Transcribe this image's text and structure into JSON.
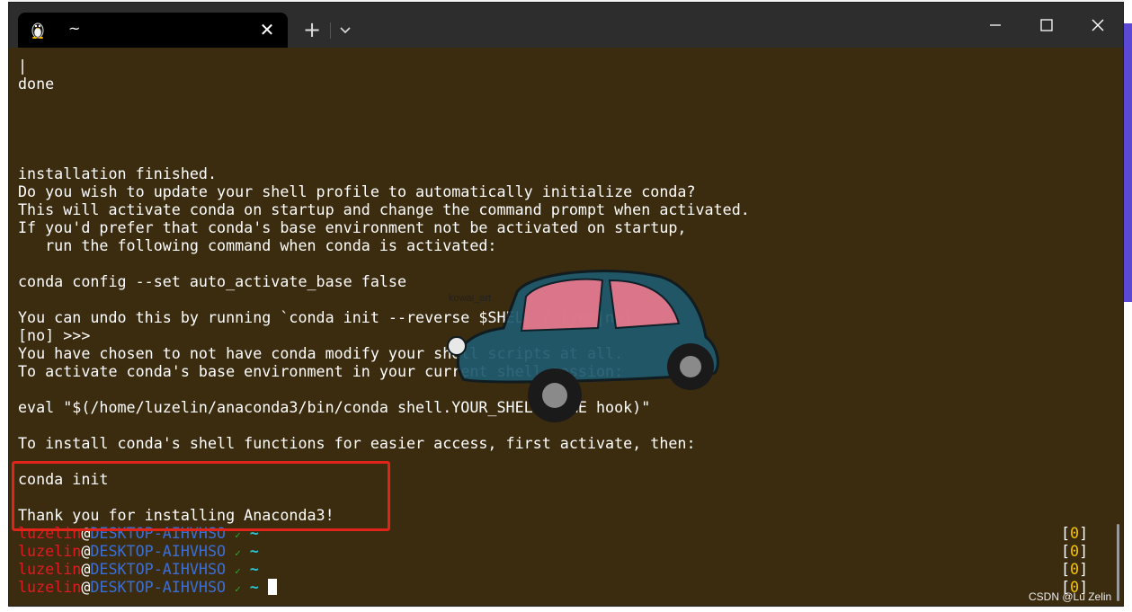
{
  "window": {
    "tab_title": "~",
    "tab_icon": "linux-penguin-icon",
    "new_tab_symbol": "+",
    "close_symbol": "✕"
  },
  "terminal": {
    "lines": [
      "|",
      "done",
      "",
      "",
      "",
      "installation finished.",
      "Do you wish to update your shell profile to automatically initialize conda?",
      "This will activate conda on startup and change the command prompt when activated.",
      "If you'd prefer that conda's base environment not be activated on startup,",
      "   run the following command when conda is activated:",
      "",
      "conda config --set auto_activate_base false",
      "",
      "You can undo this by running `conda init --reverse $SHELL`? [yes|no]",
      "[no] >>>",
      "You have chosen to not have conda modify your shell scripts at all.",
      "To activate conda's base environment in your current shell session:",
      "",
      "eval \"$(/home/luzelin/anaconda3/bin/conda shell.YOUR_SHELL_NAME hook)\"",
      "",
      "To install conda's shell functions for easier access, first activate, then:",
      "",
      "conda init",
      "",
      "Thank you for installing Anaconda3!"
    ],
    "prompt": {
      "user": "luzelin",
      "at": "@",
      "host": "DESKTOP-AIHVHSO",
      "check": "✓",
      "dir": "~",
      "status_open": "[",
      "status_value": "0",
      "status_close": "]"
    }
  },
  "watermark": {
    "car_label": "kowal_art",
    "csdn": "CSDN @Lu Zelin"
  },
  "colors": {
    "terminal_bg": "#3b2b0f",
    "titlebar_bg": "#2d2d2d",
    "highlight": "#e0241a",
    "prompt_user": "#e01b24",
    "prompt_host": "#3b6fd6",
    "status_number": "#f5c400"
  }
}
